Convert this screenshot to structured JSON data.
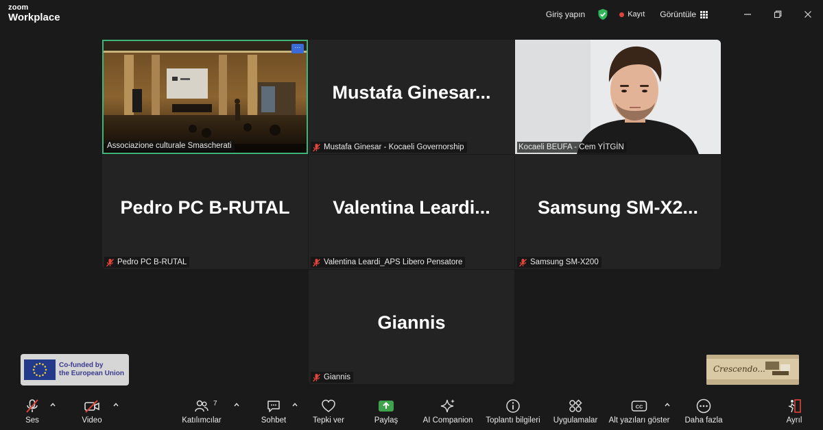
{
  "app": {
    "brand_top": "zoom",
    "brand_bottom": "Workplace"
  },
  "titlebar": {
    "signin": "Giriş yapın",
    "record": "Kayıt",
    "view": "Görüntüle"
  },
  "colors": {
    "active_border": "#3fb57c",
    "record_dot": "#e0453b",
    "share_green": "#3fa34d",
    "muted_red": "#e0453b"
  },
  "tiles": [
    {
      "label": "Associazione culturale Smascherati",
      "type": "video",
      "muted": false
    },
    {
      "name": "Mustafa  Ginesar...",
      "label": "Mustafa Ginesar - Kocaeli Governorship",
      "muted": true
    },
    {
      "label": "Kocaeli BEUFA - Cem YİTGİN",
      "type": "video",
      "muted": false
    },
    {
      "name": "Pedro PC B-RUTAL",
      "label": "Pedro PC B-RUTAL",
      "muted": true
    },
    {
      "name": "Valentina  Leardi...",
      "label": "Valentina Leardi_APS Libero Pensatore",
      "muted": true
    },
    {
      "name": "Samsung  SM-X2...",
      "label": "Samsung SM-X200",
      "muted": true
    },
    {
      "name": "Giannis",
      "label": "Giannis",
      "muted": true
    }
  ],
  "logos": {
    "eu_line1": "Co-funded by",
    "eu_line2": "the European Union",
    "crescendo": "Crescendo..."
  },
  "toolbar": {
    "audio": "Ses",
    "video": "Video",
    "participants": "Katılımcılar",
    "participants_count": "7",
    "chat": "Sohbet",
    "react": "Tepki ver",
    "share": "Paylaş",
    "ai": "AI Companion",
    "info": "Toplantı bilgileri",
    "apps": "Uygulamalar",
    "captions": "Alt yazıları göster",
    "more": "Daha fazla",
    "leave": "Ayrıl"
  }
}
